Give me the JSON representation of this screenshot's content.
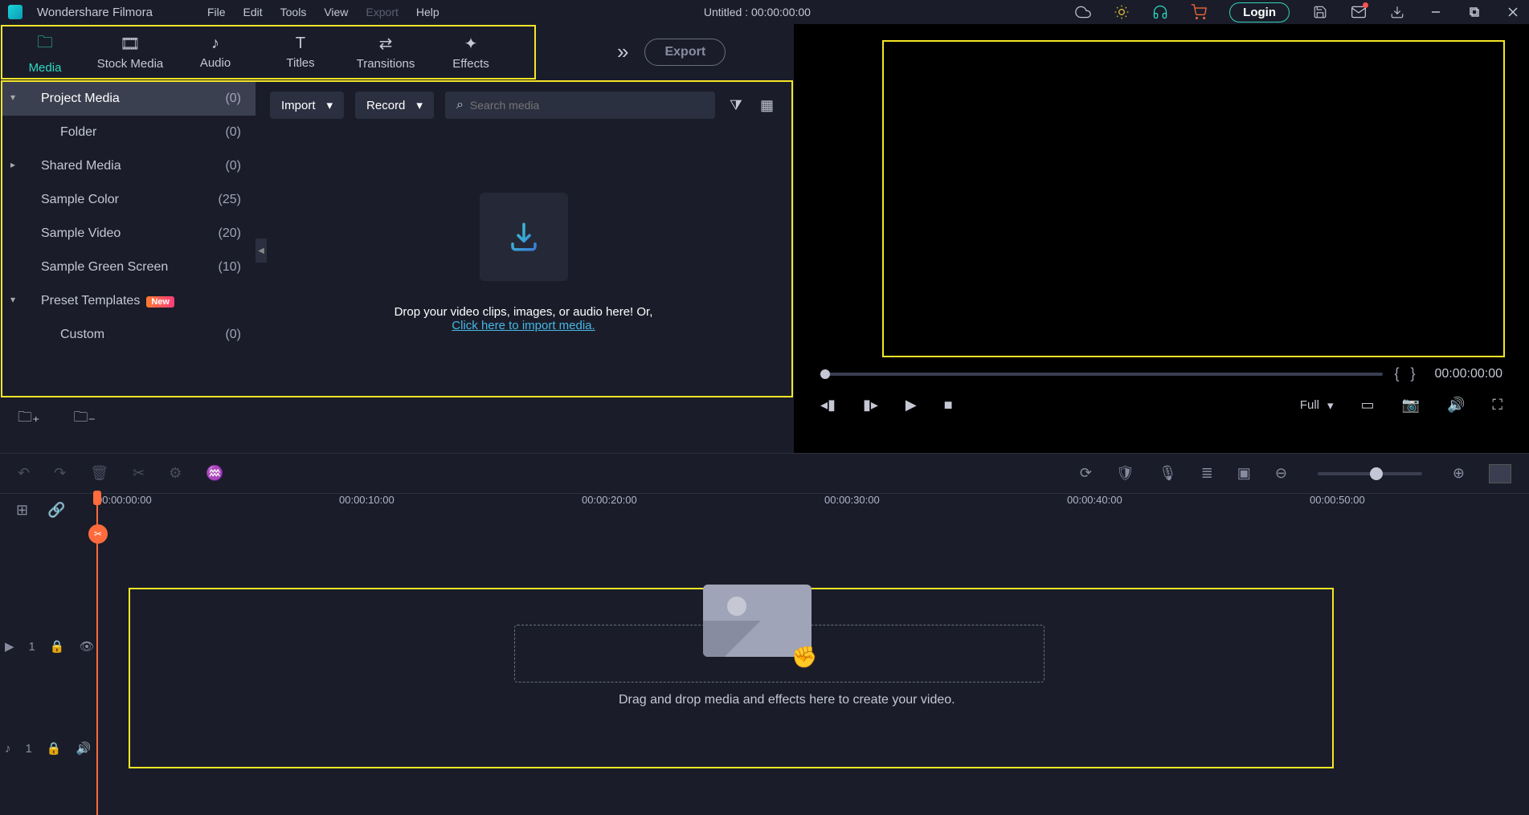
{
  "app": {
    "name": "Wondershare Filmora"
  },
  "menu": {
    "file": "File",
    "edit": "Edit",
    "tools": "Tools",
    "view": "View",
    "export": "Export",
    "help": "Help"
  },
  "doc": {
    "title": "Untitled : 00:00:00:00"
  },
  "titlebar": {
    "login": "Login"
  },
  "tabs": {
    "media": "Media",
    "stock": "Stock Media",
    "audio": "Audio",
    "titles": "Titles",
    "transitions": "Transitions",
    "effects": "Effects",
    "export": "Export"
  },
  "sidebar": {
    "items": [
      {
        "label": "Project Media",
        "count": "(0)"
      },
      {
        "label": "Folder",
        "count": "(0)"
      },
      {
        "label": "Shared Media",
        "count": "(0)"
      },
      {
        "label": "Sample Color",
        "count": "(25)"
      },
      {
        "label": "Sample Video",
        "count": "(20)"
      },
      {
        "label": "Sample Green Screen",
        "count": "(10)"
      },
      {
        "label": "Preset Templates",
        "count": ""
      },
      {
        "label": "Custom",
        "count": "(0)"
      }
    ],
    "new_badge": "New"
  },
  "media_toolbar": {
    "import": "Import",
    "record": "Record",
    "search_placeholder": "Search media"
  },
  "dropzone": {
    "text": "Drop your video clips, images, or audio here! Or,",
    "link": "Click here to import media."
  },
  "preview": {
    "braces_l": "{",
    "braces_r": "}",
    "timecode": "00:00:00:00",
    "quality": "Full"
  },
  "timeline": {
    "ticks": [
      "00:00:00:00",
      "00:00:10:00",
      "00:00:20:00",
      "00:00:30:00",
      "00:00:40:00",
      "00:00:50:00"
    ],
    "drag_hint": "Drag and drop media and effects here to create your video.",
    "track1": "1",
    "track2": "1"
  }
}
